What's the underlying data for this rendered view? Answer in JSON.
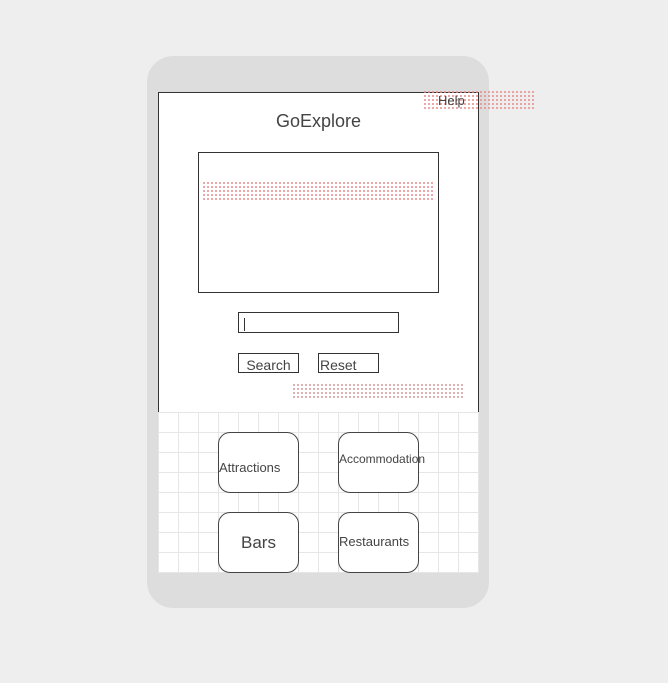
{
  "app": {
    "title": "GoExplore"
  },
  "help": {
    "label": "Help"
  },
  "search": {
    "value": "",
    "search_label": "Search",
    "reset_label": "Reset"
  },
  "categories": [
    {
      "label": "Attractions"
    },
    {
      "label": "Accommodation"
    },
    {
      "label": "Bars"
    },
    {
      "label": "Restaurants"
    }
  ],
  "colors": {
    "background": "#eeeeee",
    "phone_frame": "#dddddd",
    "screen": "#ffffff",
    "border": "#333333",
    "text": "#444444",
    "annotation_hatch": "#e88a8a"
  }
}
